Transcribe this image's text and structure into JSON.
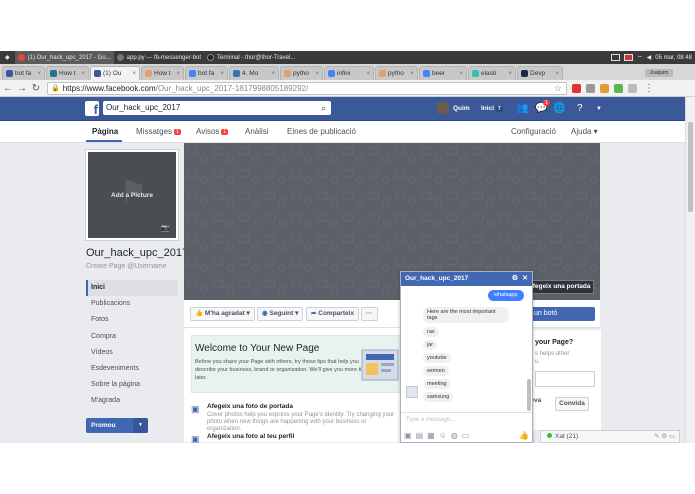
{
  "taskbar": {
    "items": [
      {
        "label": "(1) Our_hack_upc_2017 - Go...",
        "color": "#e04a3a"
      },
      {
        "label": "app.py — fb-messenger-bot",
        "color": "#777777"
      },
      {
        "label": "Terminal - thor@thor-Travel...",
        "color": "#333333"
      }
    ],
    "clock": "05 mar, 08:48"
  },
  "browser": {
    "tabs": [
      {
        "label": "bot fa",
        "color": "#3b5998"
      },
      {
        "label": "How t",
        "color": "#21759b"
      },
      {
        "label": "(1) Ou",
        "color": "#3b5998"
      },
      {
        "label": "How t",
        "color": "#e0a070"
      },
      {
        "label": "bot fa",
        "color": "#4285f4"
      },
      {
        "label": "4. Mo",
        "color": "#3776ab"
      },
      {
        "label": "pytho",
        "color": "#e0a070"
      },
      {
        "label": "infini",
        "color": "#4285f4"
      },
      {
        "label": "pytho",
        "color": "#e0a070"
      },
      {
        "label": "beer",
        "color": "#4285f4"
      },
      {
        "label": "elasti",
        "color": "#3ebeb0"
      },
      {
        "label": "Devp",
        "color": "#1b2a4a"
      }
    ],
    "user_chip": "Joaquim",
    "url_host": "https://www.facebook.com",
    "url_path": "/Our_hack_upc_2017-1817998805189292/"
  },
  "fb": {
    "search_value": "Our_hack_upc_2017",
    "user_name": "Quim",
    "home_label": "Inici",
    "home_count": "7",
    "notif_count": "1"
  },
  "pagenav": {
    "tabs": [
      {
        "label": "Pàgina"
      },
      {
        "label": "Missatges",
        "count": "1"
      },
      {
        "label": "Avisos",
        "count": "1"
      },
      {
        "label": "Anàlisi"
      },
      {
        "label": "Eines de publicació"
      }
    ],
    "settings": "Configuració",
    "help": "Ajuda ▾"
  },
  "page": {
    "add_picture": "Add a Picture",
    "name": "Our_hack_upc_2017",
    "username_prompt": "Create Page @Username",
    "sidebar": [
      "Inici",
      "Publicacions",
      "Fotos",
      "Compra",
      "Vídeos",
      "Esdeveniments",
      "Sobre la pàgina",
      "M'agrada"
    ],
    "promote": "Promou",
    "cover_button": "Afegeix una portada"
  },
  "actions": {
    "like": "M'ha agradat",
    "follow": "Seguint",
    "share": "Comparteix",
    "more": "···",
    "send": "un botó"
  },
  "welcome": {
    "title": "Welcome to Your New Page",
    "text": "Before you share your Page with others, try these tips that help you describe your business, brand or organization. We'll give you more tips later."
  },
  "tasks": [
    {
      "title": "Afegeix una foto de portada",
      "desc": "Cover photos help you express your Page's identity. Try changing your photo when new things are happening with your business or organization."
    },
    {
      "title": "Afegeix una foto al teu perfil",
      "desc": ""
    }
  ],
  "rightcard": {
    "title": "your Page?",
    "text_line1": "s helps other",
    "text_line2": "u.",
    "button1": "ova",
    "button2": "Convida"
  },
  "messenger": {
    "title": "Our_hack_upc_2017",
    "sent": "whatsapp",
    "received": [
      "Here are the most important tags",
      "rax",
      "jar",
      "youtube",
      "women",
      "meeting",
      "samsung"
    ],
    "input_placeholder": "Type a message..."
  },
  "chatbar": {
    "label": "Xat (21)"
  }
}
